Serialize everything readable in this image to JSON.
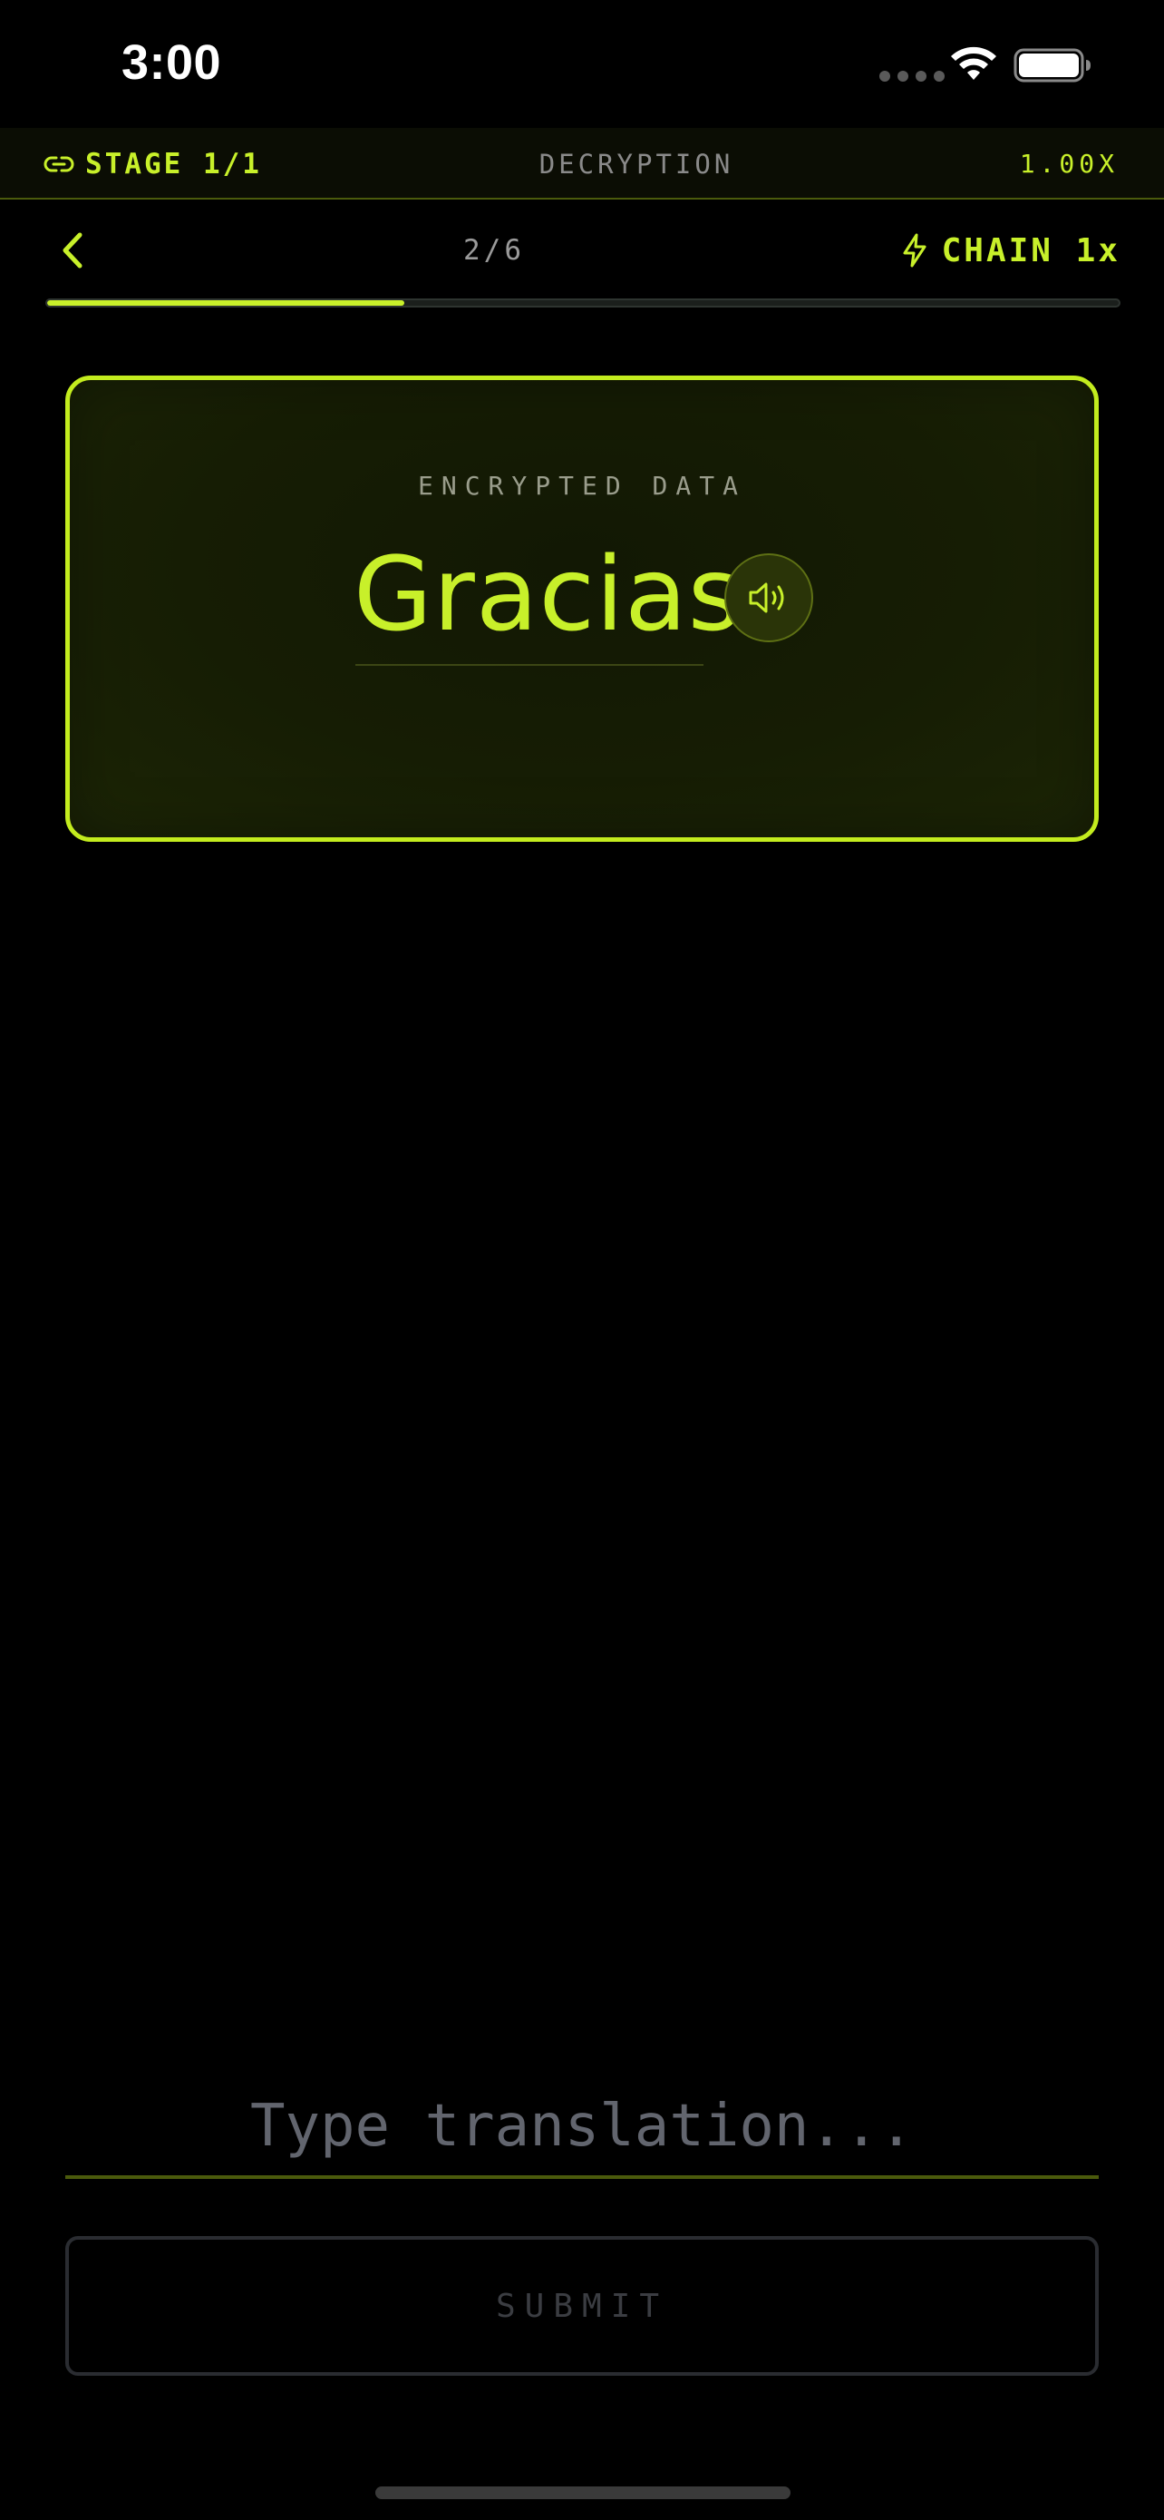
{
  "status_bar": {
    "time": "3:00"
  },
  "stage_bar": {
    "stage_label": "STAGE 1/1",
    "mode_label": "DECRYPTION",
    "multiplier": "1.00X"
  },
  "nav": {
    "counter": "2/6",
    "chain_label": "CHAIN 1x"
  },
  "progress": {
    "fraction": 0.333
  },
  "card": {
    "label": "ENCRYPTED DATA",
    "word": "Gracias"
  },
  "input": {
    "placeholder": "Type translation...",
    "value": ""
  },
  "submit": {
    "label": "SUBMIT"
  },
  "colors": {
    "accent": "#c8f02a",
    "background": "#000000",
    "card_border": "#c3ec1e",
    "muted_text": "#8a8a8a"
  },
  "icons": {
    "stage": "link-icon",
    "back": "chevron-left-icon",
    "chain": "lightning-icon",
    "audio": "speaker-icon"
  }
}
